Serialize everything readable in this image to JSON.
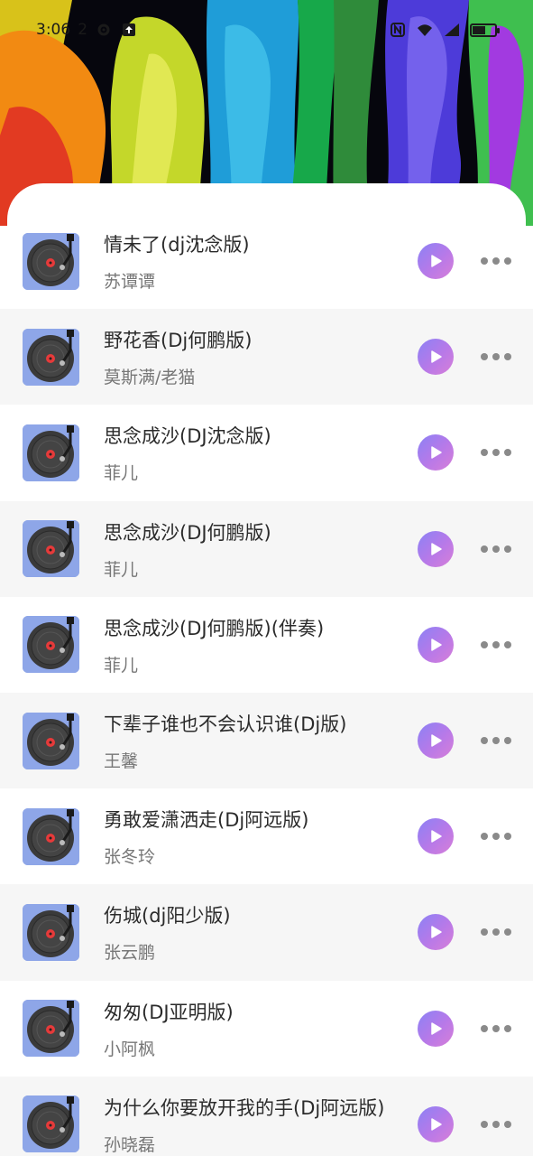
{
  "status_bar": {
    "time": "3:06",
    "extra": "2",
    "icons": [
      "settings-icon",
      "upload-icon",
      "nfc-icon",
      "wifi-icon",
      "signal-icon",
      "battery-icon"
    ],
    "battery_level": 0.6
  },
  "hero": {
    "image": "colorful-paint-splash"
  },
  "songs": [
    {
      "title": "情未了(dj沈念版)",
      "artist": "苏谭谭"
    },
    {
      "title": "野花香(Dj何鹏版)",
      "artist": "莫斯满/老猫"
    },
    {
      "title": "思念成沙(DJ沈念版)",
      "artist": "菲儿"
    },
    {
      "title": "思念成沙(DJ何鹏版)",
      "artist": "菲儿"
    },
    {
      "title": "思念成沙(DJ何鹏版)(伴奏)",
      "artist": "菲儿"
    },
    {
      "title": "下辈子谁也不会认识谁(Dj版)",
      "artist": "王馨"
    },
    {
      "title": "勇敢爱潇洒走(Dj阿远版)",
      "artist": "张冬玲"
    },
    {
      "title": "伤城(dj阳少版)",
      "artist": "张云鹏"
    },
    {
      "title": "匆匆(DJ亚明版)",
      "artist": "小阿枫"
    },
    {
      "title": "为什么你要放开我的手(Dj阿远版)",
      "artist": "孙晓磊"
    }
  ],
  "icons": {
    "cover": "vinyl-record-icon",
    "play": "play-icon",
    "more": "more-icon"
  },
  "colors": {
    "cover_bg": "#8ea6e8",
    "play_gradient_start": "#8b82f5",
    "play_gradient_end": "#d77fd8",
    "row_shade": "#f6f6f6"
  }
}
